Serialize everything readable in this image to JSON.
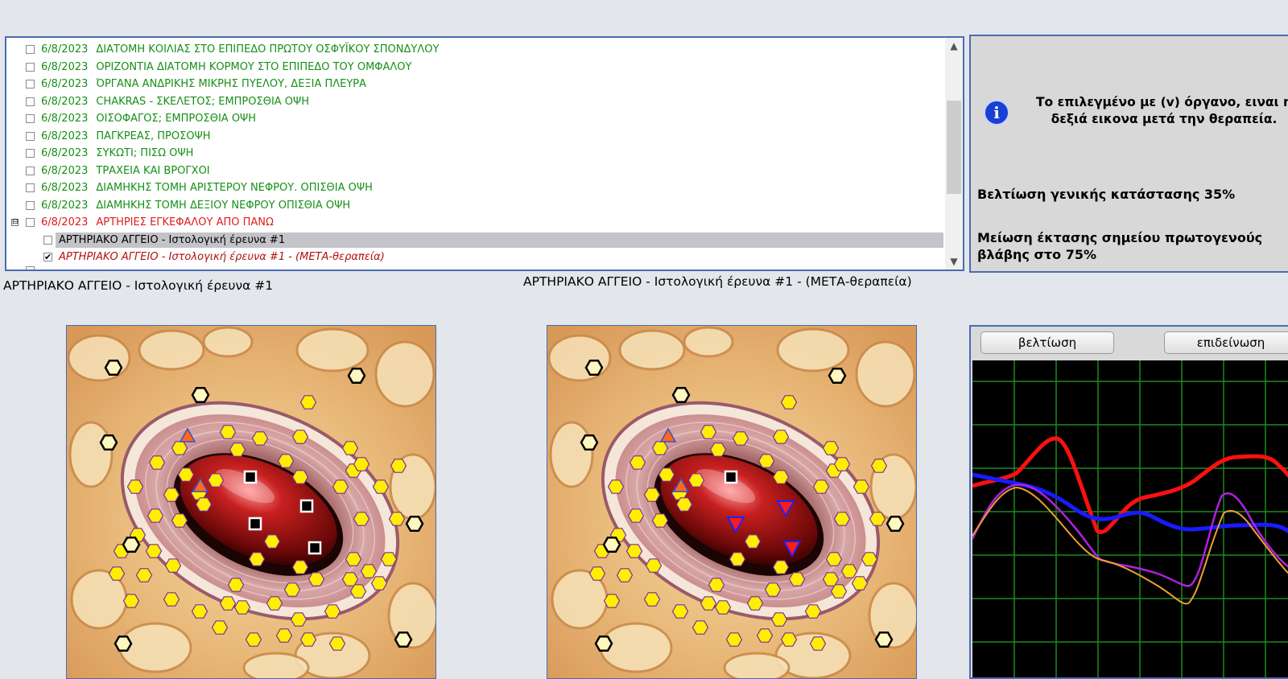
{
  "study_list": {
    "items": [
      {
        "date": "6/8/2023",
        "title": "ΔΙΑΤΟΜΗ ΚΟΙΛΙΑΣ ΣΤΟ ΕΠΙΠΕΔΟ ΠΡΩΤΟΥ ΟΣΦΥΪΚΟΥ ΣΠΟΝΔΥΛΟΥ",
        "color": "#169016"
      },
      {
        "date": "6/8/2023",
        "title": "ΟΡΙΖΟΝΤΙΑ ΔΙΑΤΟΜΗ ΚΟΡΜΟΥ ΣΤΟ ΕΠΙΠΕΔΟ ΤΟΥ ΟΜΦΑΛΟΥ",
        "color": "#169016"
      },
      {
        "date": "6/8/2023",
        "title": "ΌΡΓΑΝΑ ΑΝΔΡΙΚΗΣ ΜΙΚΡΗΣ ΠΥΕΛΟΥ, ΔΕΞΙΑ ΠΛΕΥΡΑ",
        "color": "#169016"
      },
      {
        "date": "6/8/2023",
        "title": "CHAKRAS - ΣΚΕΛΕΤΟΣ; ΕΜΠΡΟΣΘΙΑ ΟΨΗ",
        "color": "#169016"
      },
      {
        "date": "6/8/2023",
        "title": "ΟΙΣΟΦΑΓΟΣ; ΕΜΠΡΟΣΘΙΑ ΟΨΗ",
        "color": "#169016"
      },
      {
        "date": "6/8/2023",
        "title": "ΠΑΓΚΡΕΑΣ, ΠΡΟΣΟΨΗ",
        "color": "#169016"
      },
      {
        "date": "6/8/2023",
        "title": "ΣΥΚΩΤΙ; ΠΙΣΩ ΟΨΗ",
        "color": "#169016"
      },
      {
        "date": "6/8/2023",
        "title": "ΤΡΑΧΕΙΑ ΚΑΙ ΒΡΟΓΧΟΙ",
        "color": "#169016"
      },
      {
        "date": "6/8/2023",
        "title": "ΔΙΑΜΗΚΗΣ ΤΟΜΗ ΑΡΙΣΤΕΡΟΥ ΝΕΦΡΟΥ. ΟΠΙΣΘΙΑ ΟΨΗ",
        "color": "#169016"
      },
      {
        "date": "6/8/2023",
        "title": "ΔΙΑΜΗΚΗΣ ΤΟΜΗ ΔΕΞΙΟΥ ΝΕΦΡΟΥ  ΟΠΙΣΘΙΑ ΟΨΗ",
        "color": "#169016"
      },
      {
        "date": "6/8/2023",
        "title": "ΑΡΤΗΡΙΕΣ ΕΓΚΕΦΑΛΟΥ ΑΠΟ ΠΑΝΩ",
        "color": "#e01b1b"
      }
    ],
    "child_selected": "ΑΡΤΗΡΙΑΚΟ ΑΓΓΕΙΟ - Ιστολογική έρευνα #1",
    "child_post": "ΑΡΤΗΡΙΑΚΟ ΑΓΓΕΙΟ - Ιστολογική έρευνα #1 - (ΜΕΤΑ-θεραπεία)",
    "child_post_checked": true,
    "expander_symbol": "⊟",
    "checkmark": "✔",
    "scroll_up": "▲",
    "scroll_down": "▼"
  },
  "info": {
    "icon": "info-icon",
    "icon_glyph": "i",
    "message_line1": "Το επιλεγμένο με (v) όργανο, ειναι η",
    "message_line2": "δεξιά εικονα μετά την θεραπεία.",
    "improvement": "Βελτίωση γενικής κατάστασης 35%",
    "reduction_line1": "Μείωση έκτασης σημείου πρωτογενούς",
    "reduction_line2": "βλάβης στο 75%"
  },
  "captions": {
    "left": "ΑΡΤΗΡΙΑΚΟ ΑΓΓΕΙΟ - Ιστολογική έρευνα #1",
    "right": "ΑΡΤΗΡΙΑΚΟ ΑΓΓΕΙΟ - Ιστολογική έρευνα #1 - (ΜΕΤΑ-θεραπεία)"
  },
  "graph": {
    "buttons": {
      "improve": "βελτίωση",
      "worsen": "επιδείνωση"
    },
    "colors": {
      "background": "#000000",
      "grid": "#1c8a1c",
      "red": "#ff1010",
      "blue": "#1a1aff",
      "purple": "#b020e0",
      "orange": "#f0a030"
    }
  },
  "colors": {
    "accent_border": "#4a6bb3",
    "window_bg": "#e3e6ea"
  }
}
